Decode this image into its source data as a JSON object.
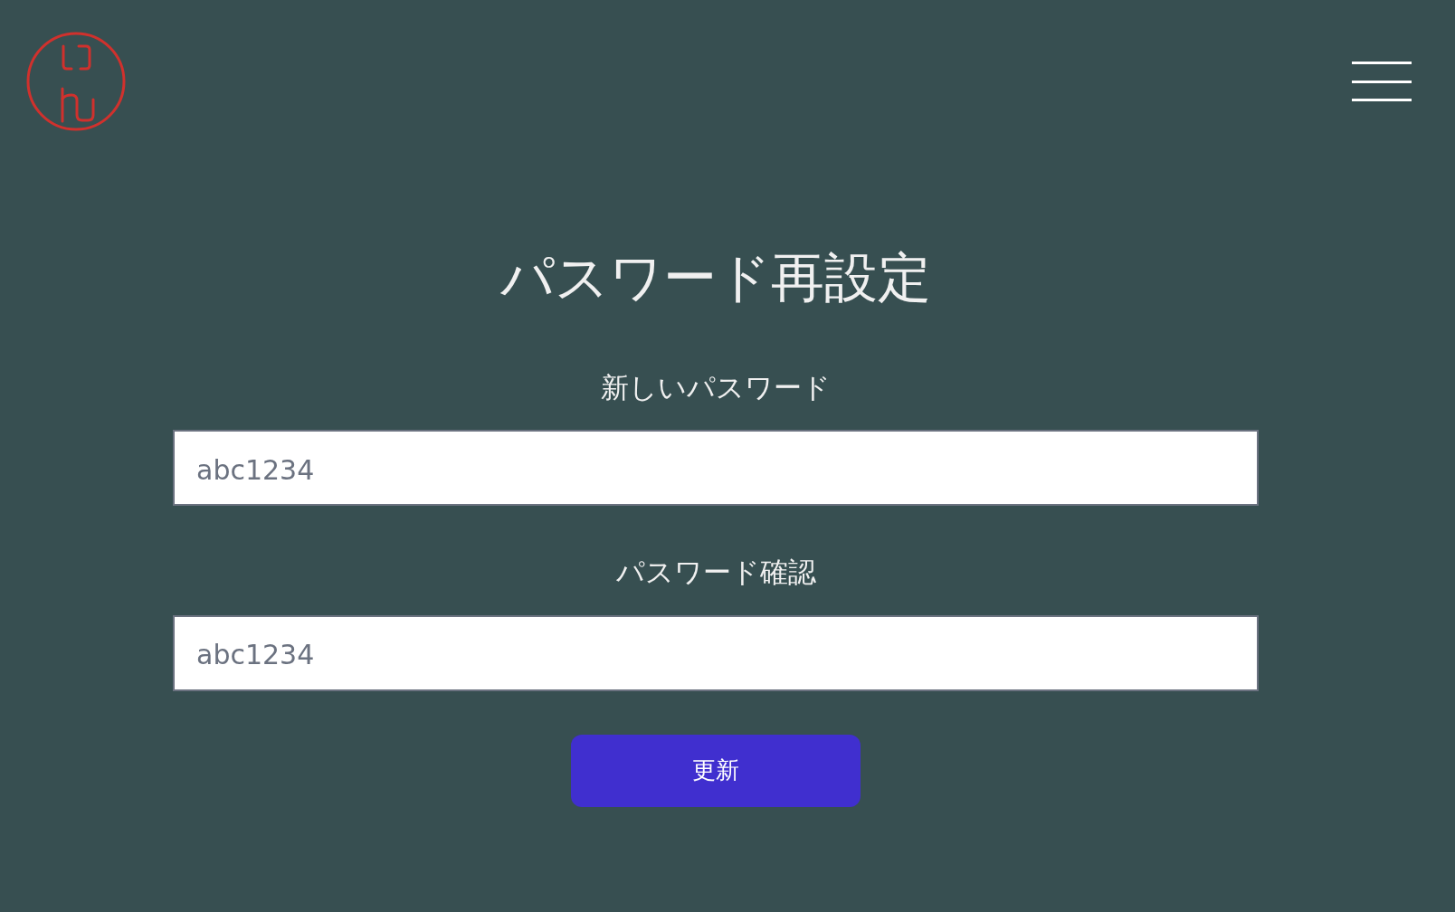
{
  "title": "パスワード再設定",
  "fields": [
    {
      "label": "新しいパスワード",
      "placeholder": "abc1234"
    },
    {
      "label": "パスワード確認",
      "placeholder": "abc1234"
    }
  ],
  "submit": "更新"
}
